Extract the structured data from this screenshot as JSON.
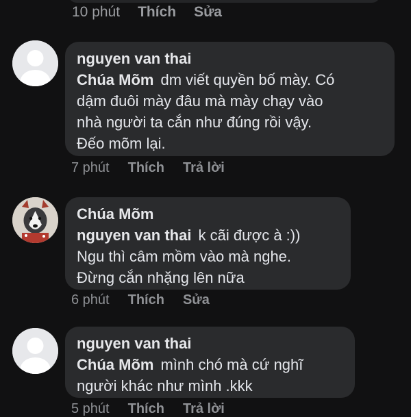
{
  "top": {
    "time": "10 phút",
    "like": "Thích",
    "edit": "Sửa"
  },
  "comments": [
    {
      "author": "nguyen van thai",
      "mention": "Chúa Mõm",
      "line1": "dm viết quyền bố mày. Có",
      "line2": "dậm đuôi mày đâu mà mày chạy vào",
      "line3": "nhà người ta cắn như đúng rồi vậy.",
      "line4": "Đếo mõm lại.",
      "time": "7 phút",
      "like": "Thích",
      "action": "Trả lời"
    },
    {
      "author": "Chúa Mõm",
      "mention": "nguyen van thai",
      "line1": "k cãi được à :))",
      "line2": "Ngu thì câm mồm vào mà nghe.",
      "line3": "Đừng cắn nhặng lên nữa",
      "time": "6 phút",
      "like": "Thích",
      "action": "Sửa"
    },
    {
      "author": "nguyen van thai",
      "mention": "Chúa Mõm",
      "line1": "mình chó mà cứ nghĩ",
      "line2": "người khác như mình .kkk",
      "time": "5 phút",
      "like": "Thích",
      "action": "Trả lời"
    }
  ],
  "colors": {
    "background": "#111112",
    "bubble": "#2a2b2d",
    "meta": "#8f9195"
  }
}
